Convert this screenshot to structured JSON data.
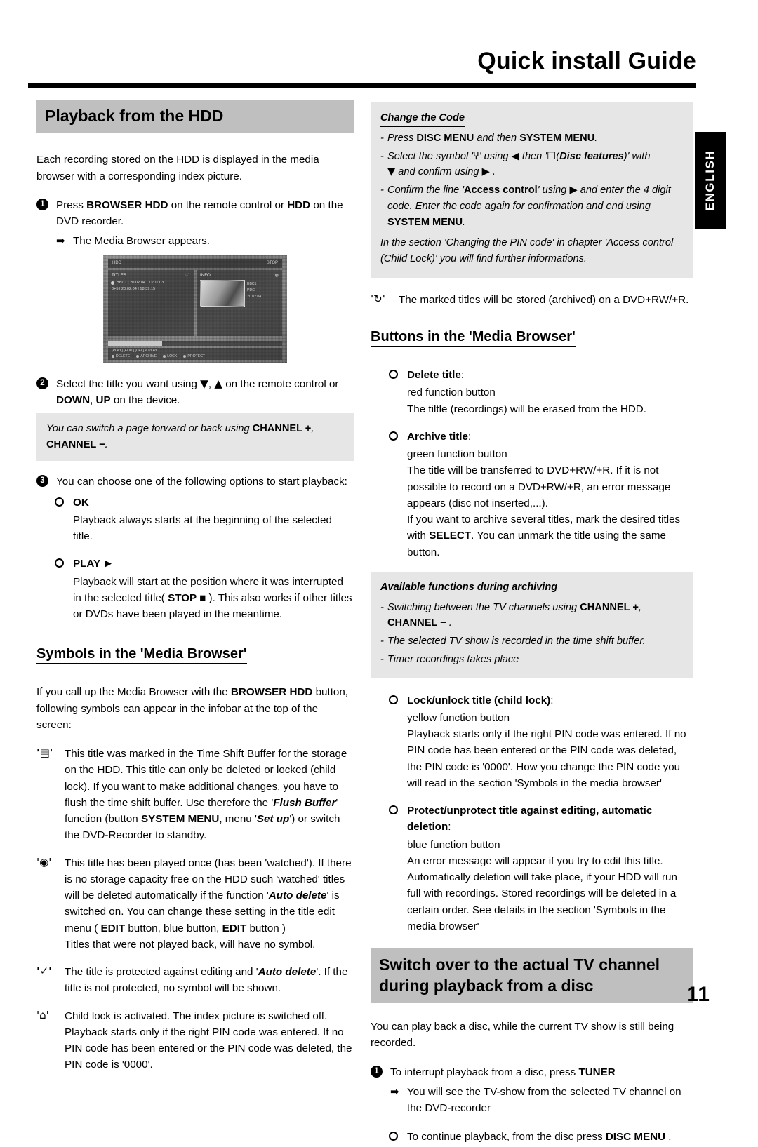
{
  "header": {
    "title": "Quick install Guide"
  },
  "lang_tab": {
    "label": "ENGLISH"
  },
  "page_number": "11",
  "left": {
    "band_title": "Playback from the HDD",
    "intro": "Each recording stored on the HDD is displayed in the media browser with a corresponding index picture.",
    "step1": {
      "num": "1",
      "text_1": "Press",
      "key_browser_hdd": "BROWSER HDD",
      "text_2": "on the remote control or",
      "key_hdd": "HDD",
      "text_3": "on the DVD recorder.",
      "result_arrow": "➡",
      "result": "The Media Browser appears."
    },
    "tv": {
      "topbar_left": "HDD",
      "topbar_right": "STOP",
      "titles_header": "TITLES",
      "titles_count": "1-1",
      "row1": "BBC1 | 20.02.04 | 13:01:03",
      "row2": "0+5 | 20.02.04 | 18:39:15",
      "info_header": "INFO",
      "meta1": "BBC1",
      "meta2": "PDC",
      "meta3": "20.02.04",
      "botbar_text": "[PLAY] [EDIT] [DEL] < PLAY",
      "key1": "DELETE",
      "key2": "ARCHIVE",
      "key3": "LOCK",
      "key4": "PROTECT"
    },
    "step2": {
      "num": "2",
      "text_1": "Select the title you want using",
      "glyph_down": "▼",
      "glyph_up": "▲",
      "text_2": "on the remote control or",
      "key_down": "DOWN",
      "key_up": "UP",
      "text_3": "on the device."
    },
    "note_channel": {
      "text_1": "You can switch a page forward or back using",
      "key_plus": "CHANNEL +",
      "key_minus": "CHANNEL −",
      "text_2": "."
    },
    "step3": {
      "num": "3",
      "text": "You can choose one of the following options to start playback:"
    },
    "option_ok": {
      "label": "OK",
      "body": "Playback always starts at the beginning of the selected title."
    },
    "option_play": {
      "label": "PLAY ►",
      "body_1": "Playback will start at the position where it was interrupted in the selected title(",
      "key_stop": "STOP ■",
      "body_2": "). This also works if other titles or DVDs have been played in the meantime."
    },
    "symbols_head": "Symbols in the 'Media Browser'",
    "symbols_intro_1": "If you call up the Media Browser with the",
    "symbols_intro_key": "BROWSER HDD",
    "symbols_intro_2": "button, following symbols can appear in the infobar at the top of the screen:",
    "symbol_timeshift": {
      "glyph": "'▤'",
      "text_1": "This title was marked in the Time Shift Buffer for the storage on the HDD. This title can only be deleted or locked (child lock). If you want to make additional changes, you have to flush the time shift buffer. Use therefore the '",
      "em_flush": "Flush Buffer",
      "text_2": "' function (button",
      "key_system_menu": "SYSTEM MENU",
      "text_3": ", menu '",
      "em_setup": "Set up",
      "text_4": "') or switch the DVD-Recorder to standby."
    },
    "symbol_watched": {
      "glyph": "'◉'",
      "text_1": "This title has been played once (has been 'watched'). If there is no storage capacity free on the HDD such 'watched' titles will be deleted automatically if the function '",
      "em_autodelete": "Auto delete",
      "text_2": "' is switched on. You can change these setting in the title edit menu (",
      "key_edit_1": "EDIT",
      "text_3": "button, blue button,",
      "key_edit_2": "EDIT",
      "text_4": "button )",
      "text_5": "Titles that were not played back, will have no symbol."
    },
    "symbol_protected": {
      "glyph": "'✓'",
      "text_1": "The title is protected against editing and '",
      "em_autodelete": "Auto delete",
      "text_2": "'. If the title is not protected, no symbol will be shown."
    },
    "symbol_childlock": {
      "glyph": "'⌂'",
      "text": "Child lock is activated. The index picture is switched off. Playback starts only if the right PIN code was entered. If no PIN code has been entered or the PIN code was deleted, the PIN code is '0000'."
    }
  },
  "right": {
    "note_change_code": {
      "heading": "Change the Code",
      "item1_a": "Press",
      "item1_key1": "DISC MENU",
      "item1_b": "and then",
      "item1_key2": "SYSTEM MENU",
      "item1_c": ".",
      "item2_a": "Select the symbol '",
      "item2_sym1": "⑂",
      "item2_b": "' using",
      "item2_glyph_left": "◀",
      "item2_c": "then '",
      "item2_sym2": "☐",
      "item2_em": "Disc features",
      "item2_d": ")' with",
      "item2_glyph_down": "▼",
      "item2_e": "and confirm using",
      "item2_glyph_right": "▶",
      "item2_f": ".",
      "item3_a": "Confirm the line '",
      "item3_em": "Access control",
      "item3_b": "' using",
      "item3_glyph_right": "▶",
      "item3_c": "and enter the 4 digit code. Enter the code again for confirmation and end using",
      "item3_key": "SYSTEM MENU",
      "item3_d": ".",
      "footer": "In the section 'Changing the PIN code' in chapter 'Access control (Child Lock)' you will find further informations."
    },
    "symbol_archive": {
      "glyph": "'↻'",
      "text": "The marked titles will be stored (archived) on a DVD+RW/+R."
    },
    "buttons_head": "Buttons in the 'Media Browser'",
    "btn_delete": {
      "label": "Delete title",
      "colon": ":",
      "line1": "red function button",
      "line2": "The tiltle (recordings) will be erased from the HDD."
    },
    "btn_archive": {
      "label": "Archive title",
      "colon": ":",
      "line1": "green function button",
      "line2": "The title will be transferred to DVD+RW/+R. If it is not possible to record on a DVD+RW/+R, an error message appears (disc not inserted,...).",
      "line3_a": "If you want to archive several titles, mark the desired titles with",
      "line3_key": "SELECT",
      "line3_b": ". You can unmark the title using the same button."
    },
    "note_archiving": {
      "heading": "Available functions during archiving",
      "item1_a": "Switching between the TV channels using",
      "item1_key1": "CHANNEL +",
      "item1_key2": "CHANNEL −",
      "item1_b": ".",
      "item2": "The selected TV show is recorded in the time shift buffer.",
      "item3": "Timer recordings takes place"
    },
    "btn_lock": {
      "label": "Lock/unlock title (child lock)",
      "colon": ":",
      "line1": "yellow function button",
      "line2": "Playback starts only if the right PIN code was entered. If no PIN code has been entered or the PIN code was deleted, the PIN code is '0000'. How you change the PIN code you will read in the section 'Symbols in the media browser'"
    },
    "btn_protect": {
      "label": "Protect/unprotect title against editing, automatic deletion",
      "colon": ":",
      "line1": "blue function button",
      "line2": "An error message will appear if you try to edit this title. Automatically deletion will take place, if your HDD will run full with recordings. Stored recordings will be deleted in a certain order. See details in the section 'Symbols in the media browser'"
    },
    "band_title": "Switch over to the actual TV channel during playback from a disc",
    "switch_intro": "You can play back a disc, while the current TV show is still being recorded.",
    "switch_step1": {
      "num": "1",
      "text_1": "To interrupt playback from a disc, press",
      "key_tuner": "TUNER",
      "result_arrow": "➡",
      "result": "You will see the TV-show from the selected TV channel on the DVD-recorder"
    },
    "switch_bullet": {
      "text_1": "To continue playback, from the disc press",
      "key_disc_menu": "DISC MENU",
      "text_2": "."
    }
  }
}
